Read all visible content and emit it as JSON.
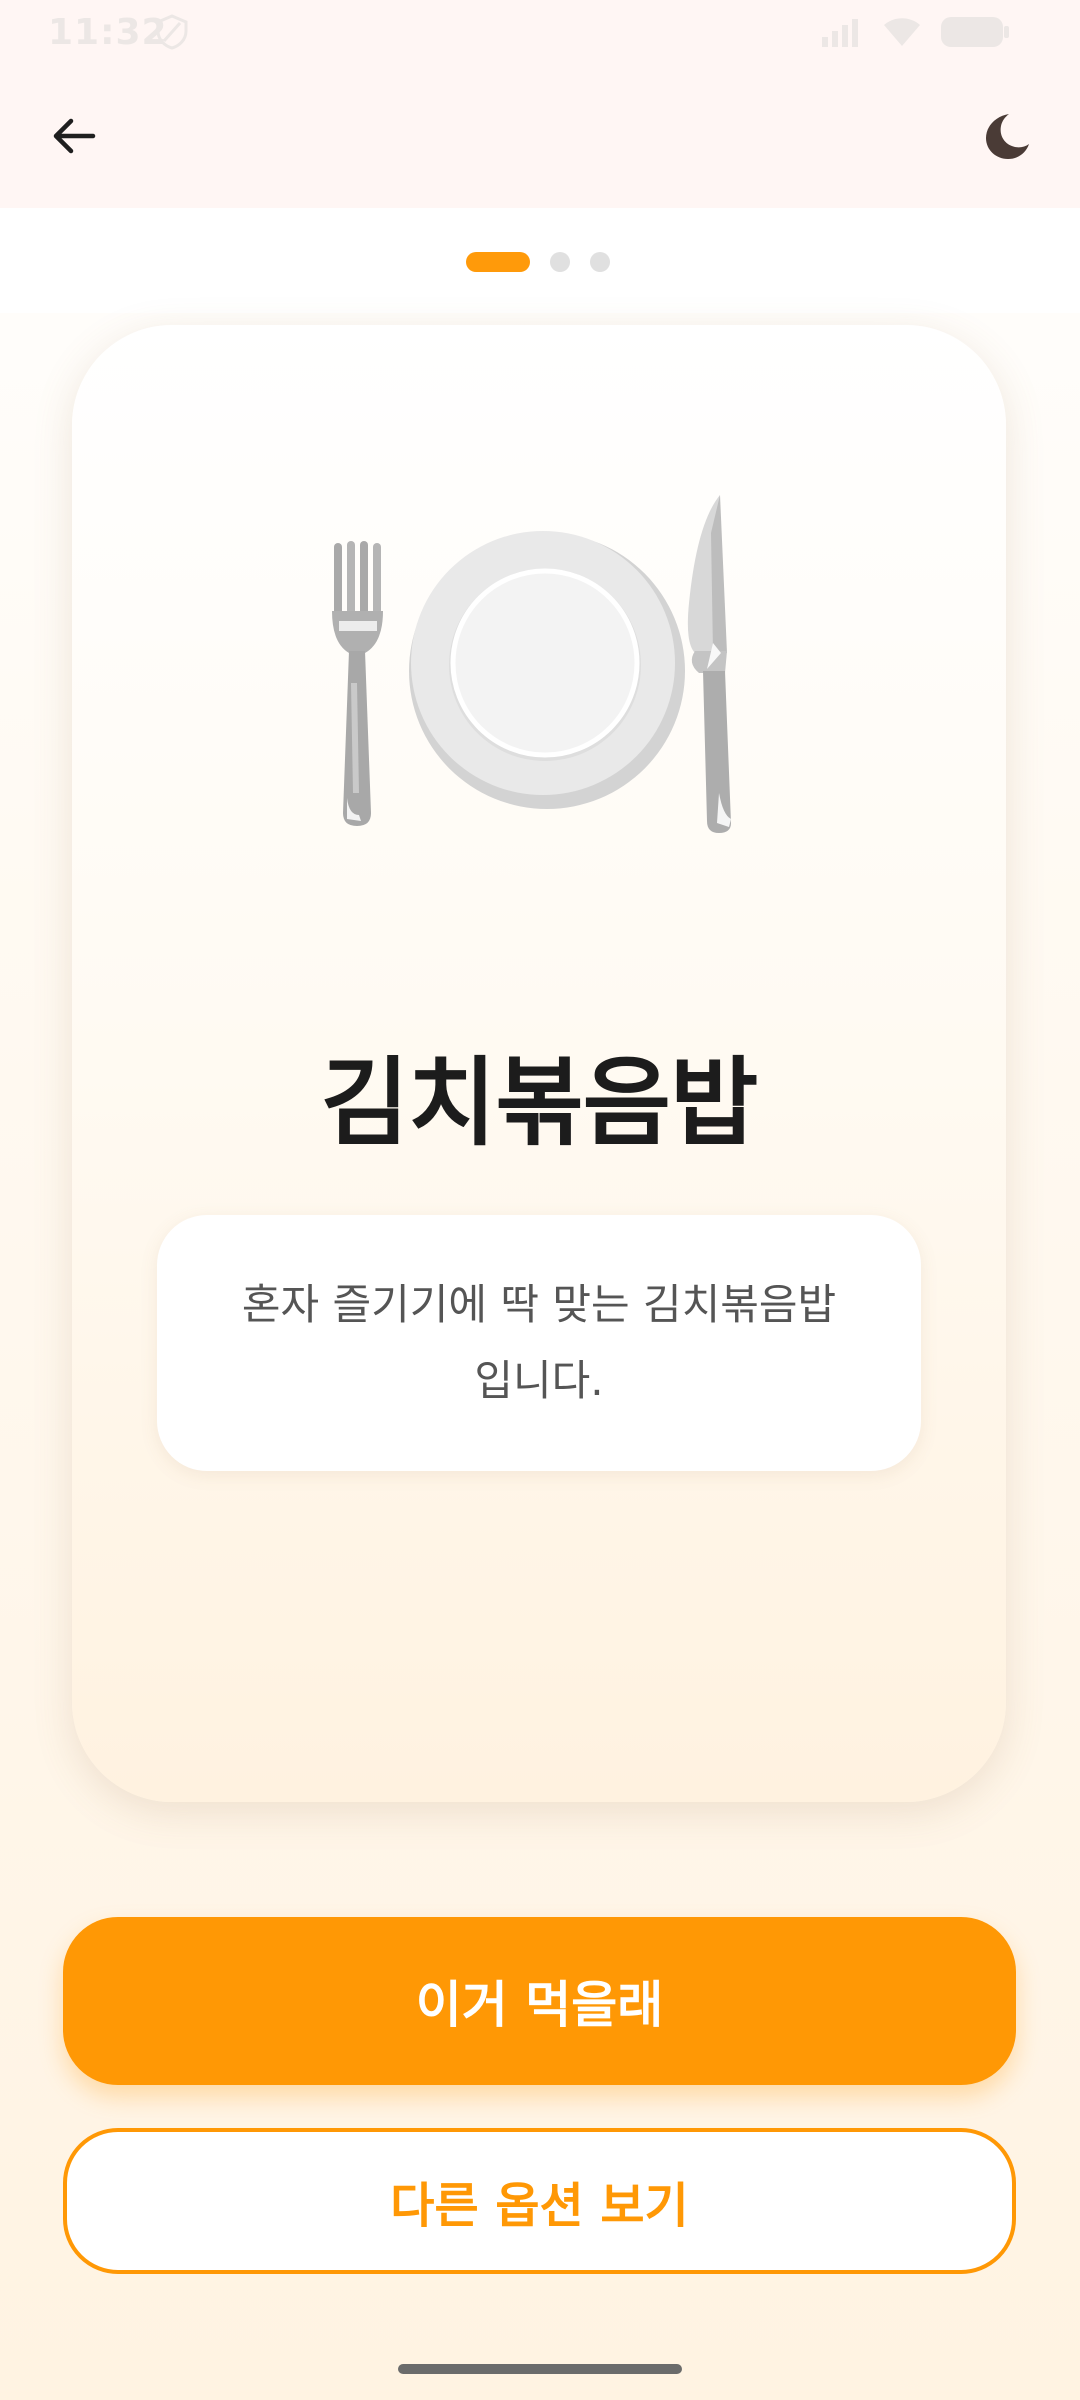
{
  "status_bar": {
    "time": "11:32"
  },
  "app_bar": {
    "back_icon": "arrow-left-icon",
    "theme_icon": "moon-icon"
  },
  "pager": {
    "total": 3,
    "current": 1
  },
  "card": {
    "illustration": "fork-knife-plate-icon",
    "title": "김치볶음밥",
    "description": "혼자 즐기기에 딱 맞는 김치볶음밥 입니다."
  },
  "actions": {
    "primary_label": "이거 먹을래",
    "secondary_label": "다른 옵션 보기"
  },
  "colors": {
    "accent": "#ff9805",
    "header_bg": "#fff6f4",
    "title_text": "#1c1c1c"
  }
}
